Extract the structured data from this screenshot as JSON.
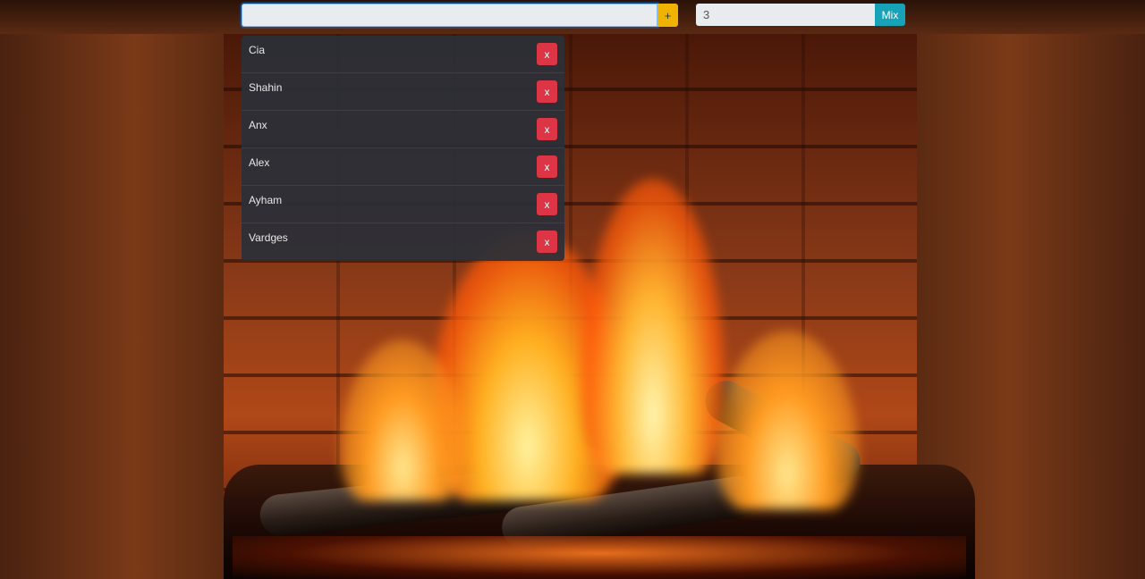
{
  "toolbar": {
    "name_input_value": "",
    "add_label": "+",
    "group_count_value": "3",
    "mix_label": "Mix"
  },
  "names": [
    {
      "label": "Cia",
      "remove_label": "x"
    },
    {
      "label": "Shahin",
      "remove_label": "x"
    },
    {
      "label": "Anx",
      "remove_label": "x"
    },
    {
      "label": "Alex",
      "remove_label": "x"
    },
    {
      "label": "Ayham",
      "remove_label": "x"
    },
    {
      "label": "Vardges",
      "remove_label": "x"
    }
  ],
  "background": {
    "icon": "fireplace-image"
  },
  "colors": {
    "add_button": "#f0b400",
    "mix_button": "#17a2b8",
    "remove_button": "#dc3545",
    "list_panel": "#2b2f38"
  }
}
